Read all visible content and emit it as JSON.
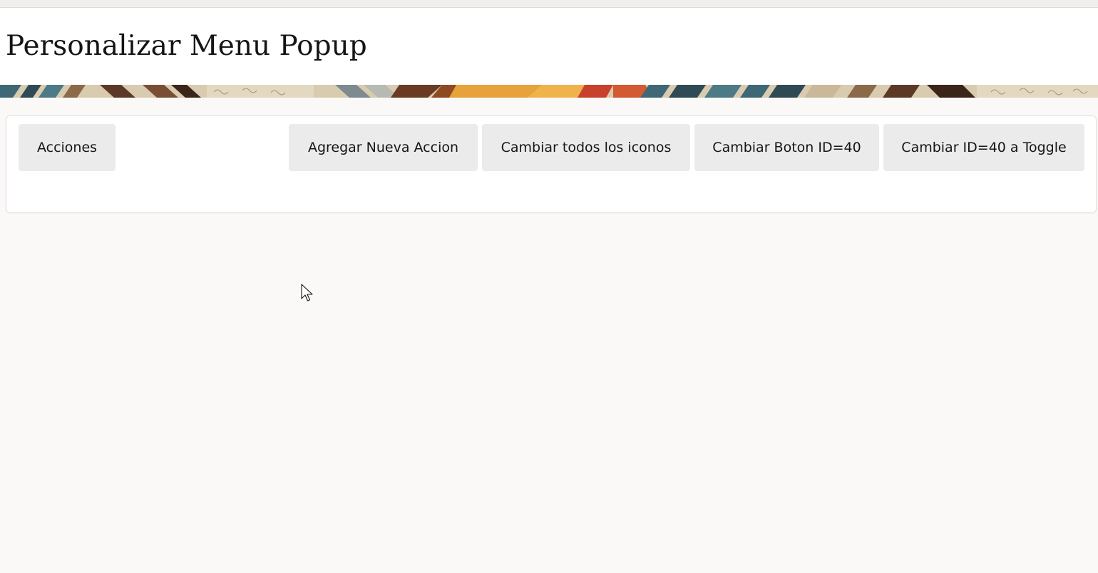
{
  "header": {
    "title": "Personalizar Menu Popup"
  },
  "toolbar": {
    "menu_button_label": "Acciones",
    "actions": [
      "Agregar Nueva Accion",
      "Cambiar todos los iconos",
      "Cambiar Boton ID=40",
      "Cambiar ID=40 a Toggle"
    ]
  },
  "colors": {
    "background": "#faf9f8",
    "button_bg": "#ebebeb",
    "banner_teal": "#3e6875",
    "banner_orange": "#e8a23a",
    "banner_red": "#c8412b",
    "banner_brown": "#6b3a22"
  }
}
